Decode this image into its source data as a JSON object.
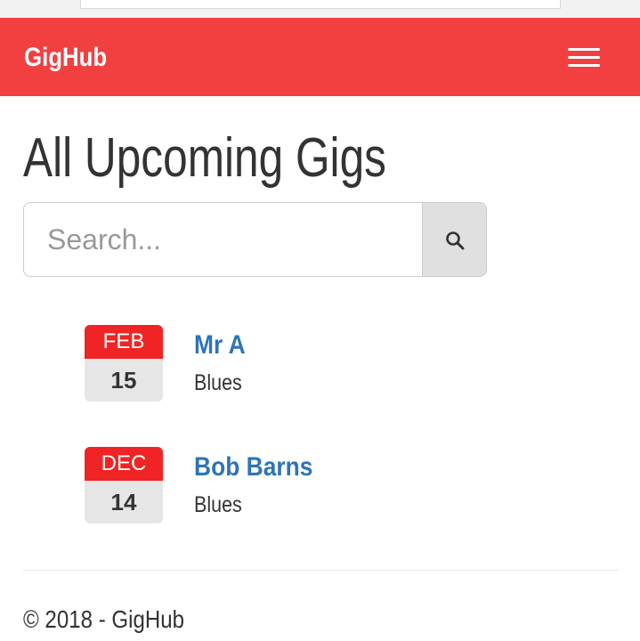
{
  "navbar": {
    "brand": "GigHub",
    "menu_icon": "hamburger-menu-icon",
    "background_color": "#f24040"
  },
  "main": {
    "title": "All Upcoming Gigs",
    "search": {
      "placeholder": "Search...",
      "value": "",
      "button_icon": "search-icon"
    },
    "gigs": [
      {
        "month": "FEB",
        "day": "15",
        "artist": "Mr A",
        "genre": "Blues"
      },
      {
        "month": "DEC",
        "day": "14",
        "artist": "Bob Barns",
        "genre": "Blues"
      }
    ]
  },
  "footer": {
    "text": "© 2018 - GigHub"
  },
  "colors": {
    "accent": "#f24040",
    "date_month_bg": "#f02424",
    "link": "#2f74b5"
  }
}
